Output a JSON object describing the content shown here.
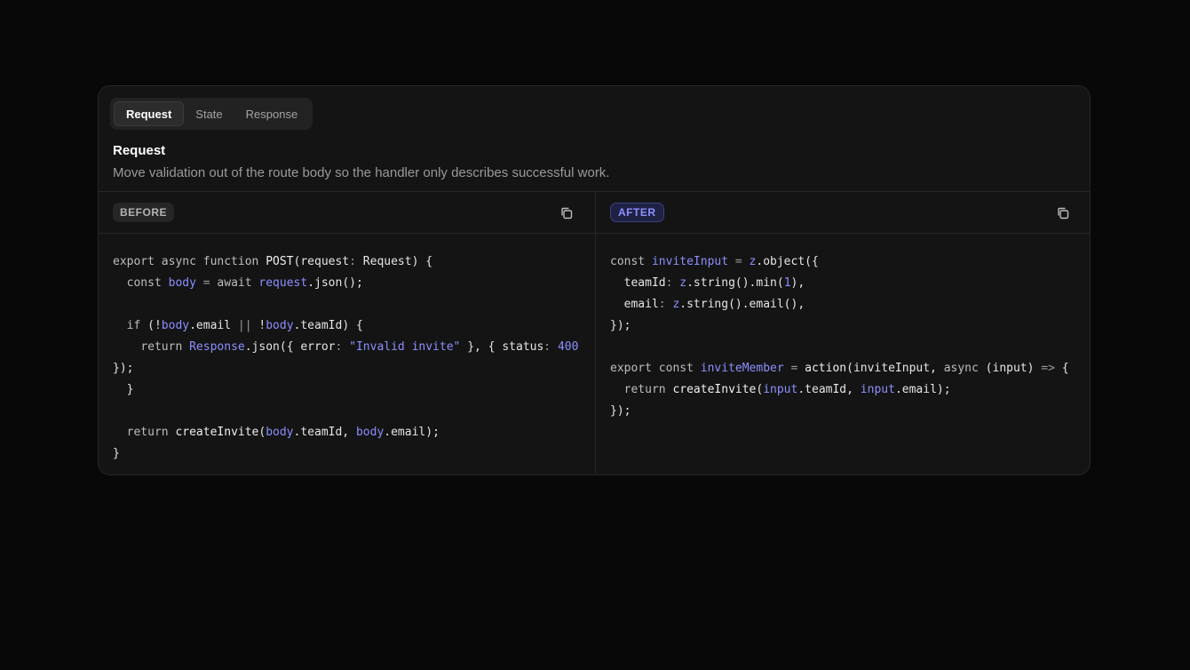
{
  "tabs": [
    {
      "label": "Request",
      "active": true
    },
    {
      "label": "State",
      "active": false
    },
    {
      "label": "Response",
      "active": false
    }
  ],
  "section": {
    "title": "Request",
    "description": "Move validation out of the route body so the handler only describes successful work."
  },
  "before": {
    "badge": "BEFORE",
    "copy_icon": "copy-icon"
  },
  "after": {
    "badge": "AFTER",
    "copy_icon": "copy-icon"
  },
  "colors": {
    "background": "#080808",
    "card": "#141414",
    "accent": "#8b8fff",
    "border": "#262626"
  }
}
